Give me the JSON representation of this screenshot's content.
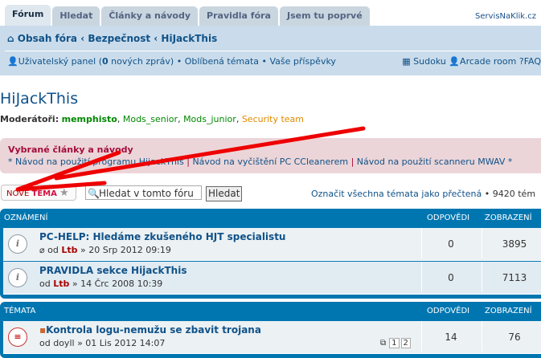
{
  "tabs": [
    "Fórum",
    "Hledat",
    "Články a návody",
    "Pravidla fóra",
    "Jsem tu poprvé"
  ],
  "brand": "ServisNaKlik.cz",
  "breadcrumb": [
    "Obsah fóra",
    "Bezpečnost",
    "HiJackThis"
  ],
  "userlinks": {
    "panel": "Uživatelský panel (",
    "count": "0",
    "panel_end": " nových zpráv)",
    "fav": "Oblíbená témata",
    "posts": "Vaše příspěvky",
    "sudoku": "Sudoku",
    "arcade": "Arcade room",
    "faq": "FAQ"
  },
  "forum_title": "HiJackThis",
  "moderators": {
    "label": "Moderátoři:",
    "names": [
      "memphisto",
      "Mods_senior",
      "Mods_junior",
      "Security team"
    ]
  },
  "featured": {
    "title": "Vybrané články a návody",
    "links": [
      "Návod na použití programu HijackThis",
      "Návod na vyčištění PC CCleanerem",
      "Návod na použití scanneru MWAV"
    ]
  },
  "actions": {
    "new_topic_a": "NOVÉ ",
    "new_topic_b": "TÉMA",
    "search_placeholder": "Hledat v tomto fóru",
    "search_button": "Hledat",
    "mark_read": "Označit všechna témata jako přečtená",
    "topic_count": "• 9420 tém"
  },
  "announcements": {
    "header": "OZNÁMENÍ",
    "col_replies": "ODPOVĚDI",
    "col_views": "ZOBRAZENÍ",
    "rows": [
      {
        "title": "PC-HELP: Hledáme zkušeného HJT specialistu",
        "author": "Ltb",
        "date": "» 20 Srp 2012 09:19",
        "replies": "0",
        "views": "3895"
      },
      {
        "title": "PRAVIDLA sekce HijackThis",
        "author": "Ltb",
        "date": "» 14 Črc 2008 10:39",
        "replies": "0",
        "views": "7113"
      }
    ]
  },
  "topics": {
    "header": "TÉMATA",
    "col_replies": "ODPOVĚDI",
    "col_views": "ZOBRAZENÍ",
    "rows": [
      {
        "title": "Kontrola logu-nemužu se zbavit trojana",
        "author": "doyll",
        "date": "» 01 Lis 2012 14:07",
        "pages": [
          "1",
          "2"
        ],
        "replies": "14",
        "views": "76"
      }
    ]
  },
  "by": "od"
}
